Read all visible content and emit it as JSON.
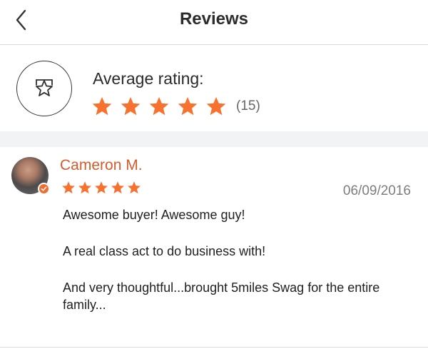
{
  "header": {
    "title": "Reviews",
    "back_icon": "chevron-left-icon"
  },
  "summary": {
    "badge_icon": "star-badge-icon",
    "label": "Average rating:",
    "rating": 5,
    "max_rating": 5,
    "count_text": "(15)",
    "star_color": "#f6722e"
  },
  "reviews": [
    {
      "name": "Cameron M.",
      "rating": 5,
      "date": "06/09/2016",
      "verified_icon": "verified-check-icon",
      "text": [
        "Awesome buyer! Awesome guy!",
        "A real class act to do business with!",
        "And very thoughtful...brought 5miles Swag for the entire family..."
      ]
    }
  ]
}
